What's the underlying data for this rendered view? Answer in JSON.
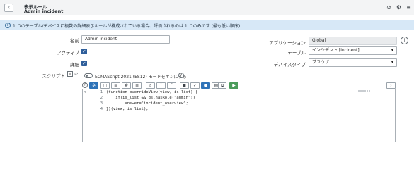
{
  "header": {
    "title": "表示ルール",
    "subtitle": "Admin incident",
    "back_icon": "chevron-left-icon",
    "actions": [
      "paperclip-icon",
      "settings-sliders-icon",
      "more-menu-icon"
    ]
  },
  "banner": {
    "icon": "info-icon",
    "text": "1 つのテーブル/デバイスに複数の詳細表示ルールが構成されている場合、評価されるのは 1 つのみです (最も低い順序)"
  },
  "form": {
    "name": {
      "label": "名前",
      "value": "Admin incident"
    },
    "active": {
      "label": "アクティブ",
      "checked": true
    },
    "details": {
      "label": "詳細",
      "checked": true
    },
    "script": {
      "label": "スクリプト",
      "label_icons": [
        "document-icon",
        "code-icon"
      ],
      "toggle_text": "ECMAScript 2021 (ES12) モードをオンにする",
      "toggle_on": false
    },
    "application": {
      "label": "アプリケーション",
      "value": "Global"
    },
    "table": {
      "label": "テーブル",
      "value": "インシデント [incident]"
    },
    "device_type": {
      "label": "デバイスタイプ",
      "value": "ブラウザ"
    }
  },
  "editor": {
    "toolbar": [
      "help-icon",
      "script-include-icon",
      "comment-icon",
      "format-icon",
      "toggle-comment-icon",
      "replace-icon",
      "search-icon",
      "up-icon",
      "down-icon",
      "syntax-check-icon",
      "debug-icon",
      "save-icon",
      "fullscreen-icon",
      "test-icon",
      "expand-right-icon"
    ],
    "line_numbers": [
      "1",
      "2",
      "3",
      "4"
    ],
    "code": [
      "(function overrideView(view, is_list) {",
      "    if(is_list && gs.hasRole(\"admin\"))",
      "        answer=\"incident_overview\";",
      "})(view, is_list);"
    ]
  },
  "colors": {
    "header_bg": "#f3f4f5",
    "banner_bg": "#d7e8f7",
    "checkbox": "#2e5e9a",
    "toolbar_active": "#2e73b8",
    "toolbar_green": "#4b9b5a"
  }
}
